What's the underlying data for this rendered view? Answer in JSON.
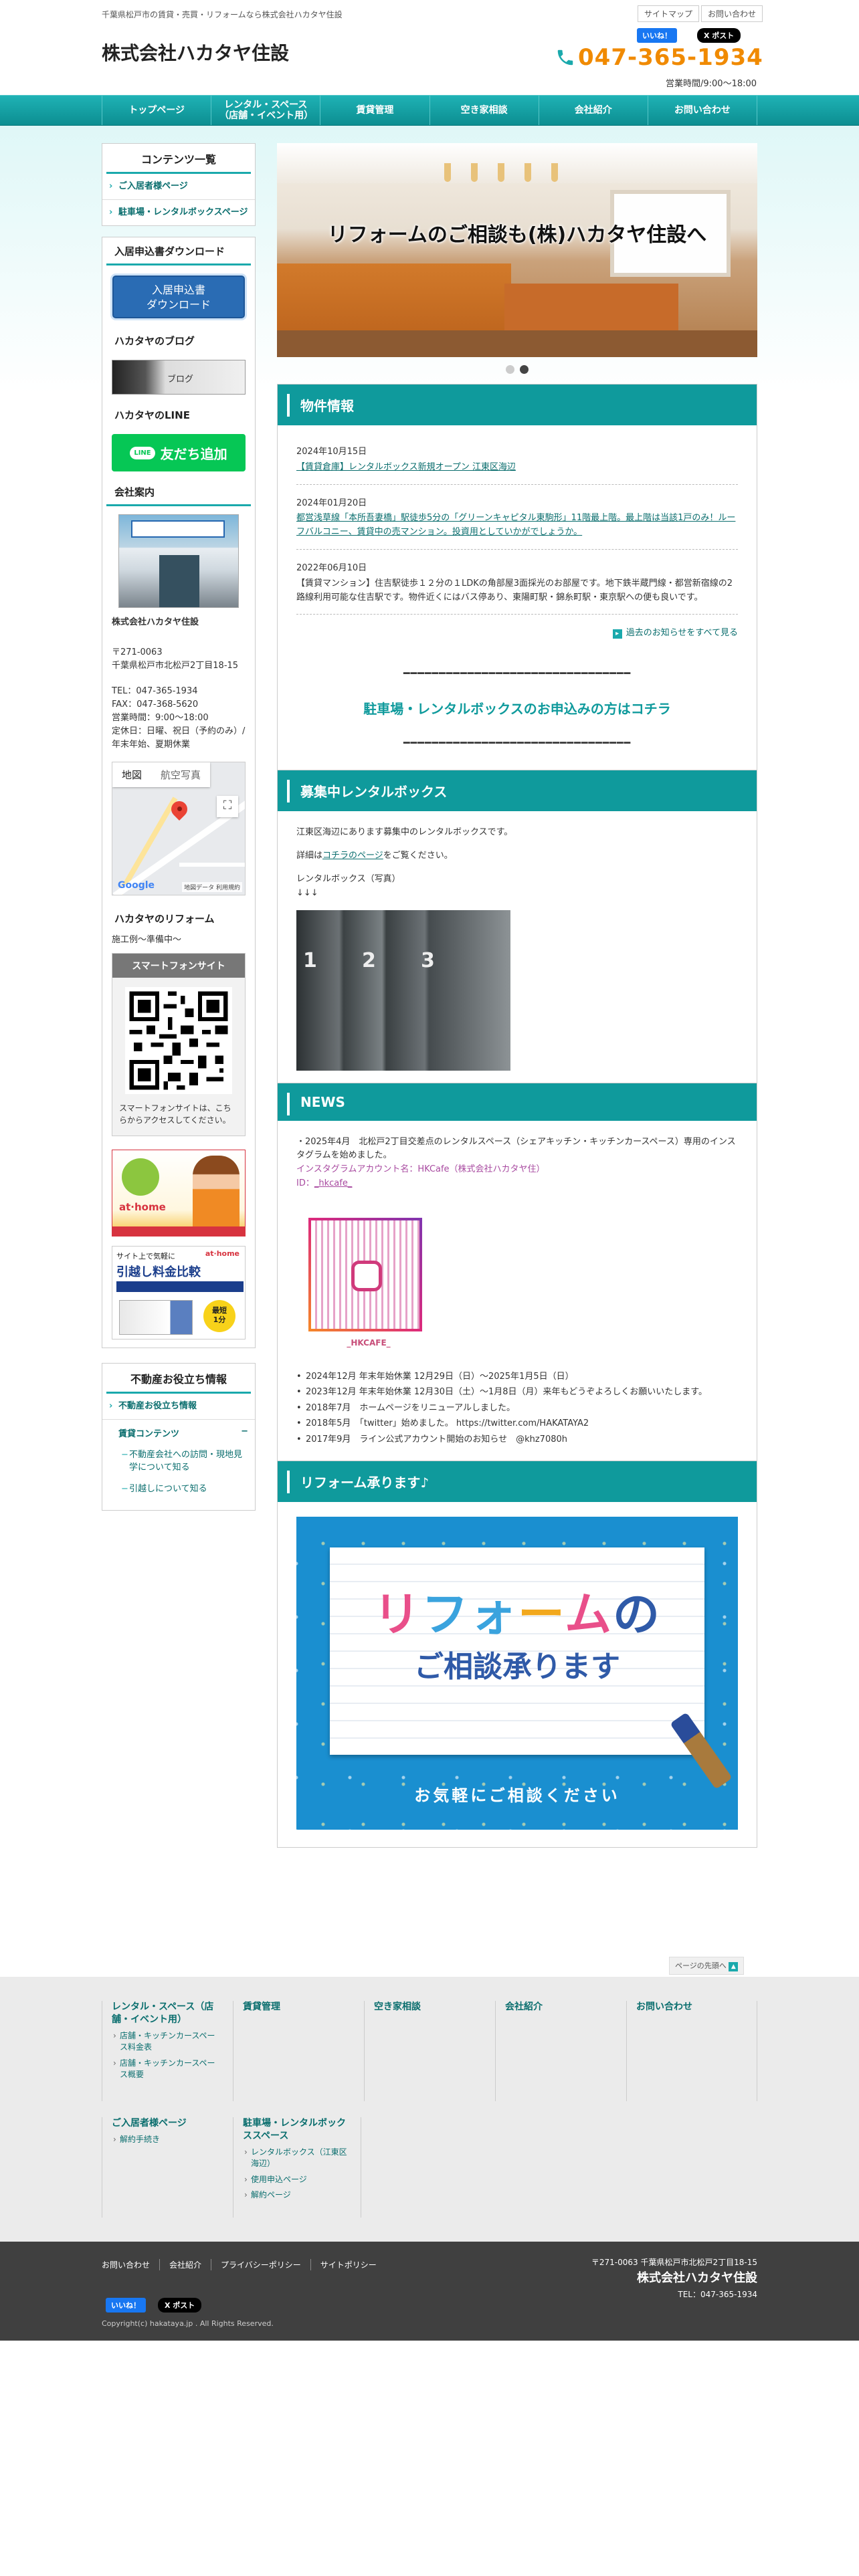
{
  "header": {
    "tagline": "千葉県松戸市の賃貸・売買・リフォームなら株式会社ハカタヤ住設",
    "company": "株式会社ハカタヤ住設",
    "utility_links": [
      "サイトマップ",
      "お問い合わせ"
    ],
    "fb_like": "いいね！",
    "x_post": "X ポスト",
    "phone": "047-365-1934",
    "hours": "営業時間/9:00〜18:00"
  },
  "nav": [
    "トップページ",
    "レンタル・スペース（店舗・イベント用）",
    "賃貸管理",
    "空き家相談",
    "会社紹介",
    "お問い合わせ"
  ],
  "sidebar": {
    "contents_title": "コンテンツ一覧",
    "contents_items": [
      "ご入居者様ページ",
      "駐車場・レンタルボックスページ"
    ],
    "download_title": "入居申込書ダウンロード",
    "download_button": "入居申込書\nダウンロード",
    "blog_title": "ハカタヤのブログ",
    "blog_label": "ブログ",
    "line_title": "ハカタヤのLINE",
    "line_logo": "LINE",
    "line_button": "友だち追加",
    "company_title": "会社案内",
    "company_name": "株式会社ハカタヤ住設",
    "postal": "〒271-0063",
    "address": "千葉県松戸市北松戸2丁目18-15",
    "tel": "TEL：047-365-1934",
    "fax": "FAX：047-368-5620",
    "hours": "営業時間：9:00〜18:00",
    "holidays": "定休日：日曜、祝日（予約のみ）/ 年末年始、夏期休業",
    "map_tabs": [
      "地図",
      "航空写真"
    ],
    "map_google": "Google",
    "map_footer": "地図データ 利用規約",
    "reform_title": "ハカタヤのリフォーム",
    "reform_text": "施工例〜準備中〜",
    "sp_title": "スマートフォンサイト",
    "sp_text": "スマートフォンサイトは、こちらからアクセスしてください。",
    "athome_logo": "at·home",
    "move_head": "サイト上で気軽に",
    "move_athome": "at·home",
    "move_title": "引越し料金比較",
    "move_badge": "最短\n1分",
    "useful_title": "不動産お役立ち情報",
    "useful_item": "不動産お役立ち情報",
    "rental_head": "賃貸コンテンツ",
    "rental_toggle": "−",
    "rental_subs": [
      "不動産会社への訪問・現地見学について知る",
      "引越しについて知る"
    ]
  },
  "hero": {
    "caption": "リフォームのご相談も(株)ハカタヤ住設へ"
  },
  "property": {
    "title": "物件情報",
    "entries": [
      {
        "date": "2024年10月15日",
        "text": "【賃貸倉庫】レンタルボックス新規オープン 江東区海辺"
      },
      {
        "date": "2024年01月20日",
        "text": "都営浅草線「本所吾妻橋」駅徒歩5分の「グリーンキャピタル東駒形」11階最上階。最上階は当該1戸のみ！ルーフバルコニー、賃貸中の売マンション。投資用としていかがでしょうか。"
      },
      {
        "date": "2022年06月10日",
        "text": "【賃貸マンション】住吉駅徒歩１２分の１LDKの角部屋3面採光のお部屋です。地下鉄半蔵門線・都営新宿線の2路線利用可能な住吉駅です。物件近くにはバス停あり、東陽町駅・錦糸町駅・東京駅への便も良いです。"
      }
    ],
    "more": "過去のお知らせをすべて見る",
    "dashes": "━━━━━━━━━━━━━━━━━━━━━━━━━━━━━━━━",
    "parking_text": "駐車場・レンタルボックスのお申込みの方は",
    "parking_link": "コチラ"
  },
  "rental": {
    "title": "募集中レンタルボックス",
    "p1": "江東区海辺にあります募集中のレンタルボックスです。",
    "p2_pre": "詳細は",
    "p2_link": "コチラのページ",
    "p2_post": "をご覧ください。",
    "p3": "レンタルボックス（写真）",
    "arrows": "↓↓↓",
    "box_numbers": [
      "1",
      "2",
      "3"
    ]
  },
  "news": {
    "title": "NEWS",
    "intro": "・2025年4月　北松戸2丁目交差点のレンタルスペース（シェアキッチン・キッチンカースペース）専用のインスタグラムを始めました。",
    "insta_line1": "インスタグラムアカウント名：HKCafe（株式会社ハカタヤ住）",
    "insta_id_label": "ID：",
    "insta_id": "_hkcafe_",
    "qr_handle": "_HKCAFE_",
    "items": [
      "2024年12月 年末年始休業 12月29日（日）〜2025年1月5日（日）",
      "2023年12月 年末年始休業 12月30日（土）〜1月8日（月）来年もどうぞよろしくお願いいたします。",
      "2018年7月　ホームページをリニューアルしました。",
      "2018年5月　「twitter」始めました。 https://twitter.com/HAKATAYA2",
      "2017年9月　ライン公式アカウント開始のお知らせ　@khz7080h"
    ]
  },
  "reform": {
    "title": "リフォーム承ります♪",
    "banner_t1": [
      "リ",
      "フォ",
      "ー",
      "ム",
      "の"
    ],
    "banner_t2": "ご相談承ります",
    "banner_sub": "お気軽にご相談ください"
  },
  "pagetop": "ページの先頭へ",
  "footer": {
    "cols_row1": [
      {
        "head": "レンタル・スペース（店舗・イベント用）",
        "subs": [
          "店舗・キッチンカースペース料金表",
          "店舗・キッチンカースペース概要"
        ]
      },
      {
        "head": "賃貸管理",
        "subs": []
      },
      {
        "head": "空き家相談",
        "subs": []
      },
      {
        "head": "会社紹介",
        "subs": []
      },
      {
        "head": "お問い合わせ",
        "subs": []
      }
    ],
    "cols_row2": [
      {
        "head": "ご入居者様ページ",
        "subs": [
          "解約手続き"
        ]
      },
      {
        "head": "駐車場・レンタルボックススペース",
        "subs": [
          "レンタルボックス（江東区海辺）",
          "使用申込ページ",
          "解約ページ"
        ]
      }
    ],
    "links": [
      "お問い合わせ",
      "会社紹介",
      "プライバシーポリシー",
      "サイトポリシー"
    ],
    "address": "〒271-0063 千葉県松戸市北松戸2丁目18-15",
    "name": "株式会社ハカタヤ住設",
    "tel": "TEL：047-365-1934",
    "fb_like": "いいね！",
    "x_post": "X ポスト",
    "copyright": "Copyright(c) hakataya.jp . All Rights Reserved."
  }
}
